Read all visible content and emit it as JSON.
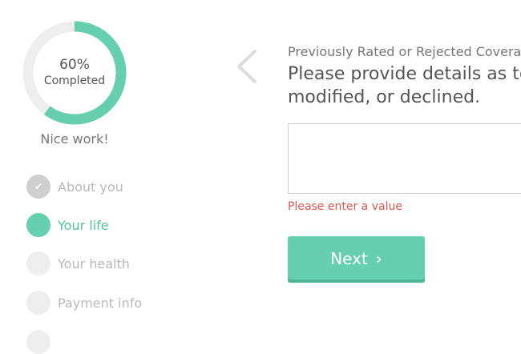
{
  "progress": {
    "percent_label": "60%",
    "completed_label": "Completed",
    "fraction": 0.6,
    "ring_color": "#66cfae",
    "track_color": "#eeeeee"
  },
  "encouragement": "Nice work!",
  "steps": [
    {
      "label": "About you",
      "state": "done",
      "icon": "check-icon"
    },
    {
      "label": "Your life",
      "state": "active"
    },
    {
      "label": "Your health",
      "state": "pending"
    },
    {
      "label": "Payment info",
      "state": "pending"
    },
    {
      "label": "",
      "state": "pending"
    }
  ],
  "question": {
    "subtitle": "Previously Rated or Rejected Coverage",
    "title_line1": "Please provide details as to",
    "title_line2": "modified, or declined.",
    "answer_value": "",
    "error": "Please enter a value"
  },
  "nav": {
    "back_icon": "chevron-left-icon",
    "next_label": "Next",
    "next_icon": "chevron-right-icon"
  },
  "colors": {
    "accent": "#66cfae",
    "error": "#e0544c"
  }
}
